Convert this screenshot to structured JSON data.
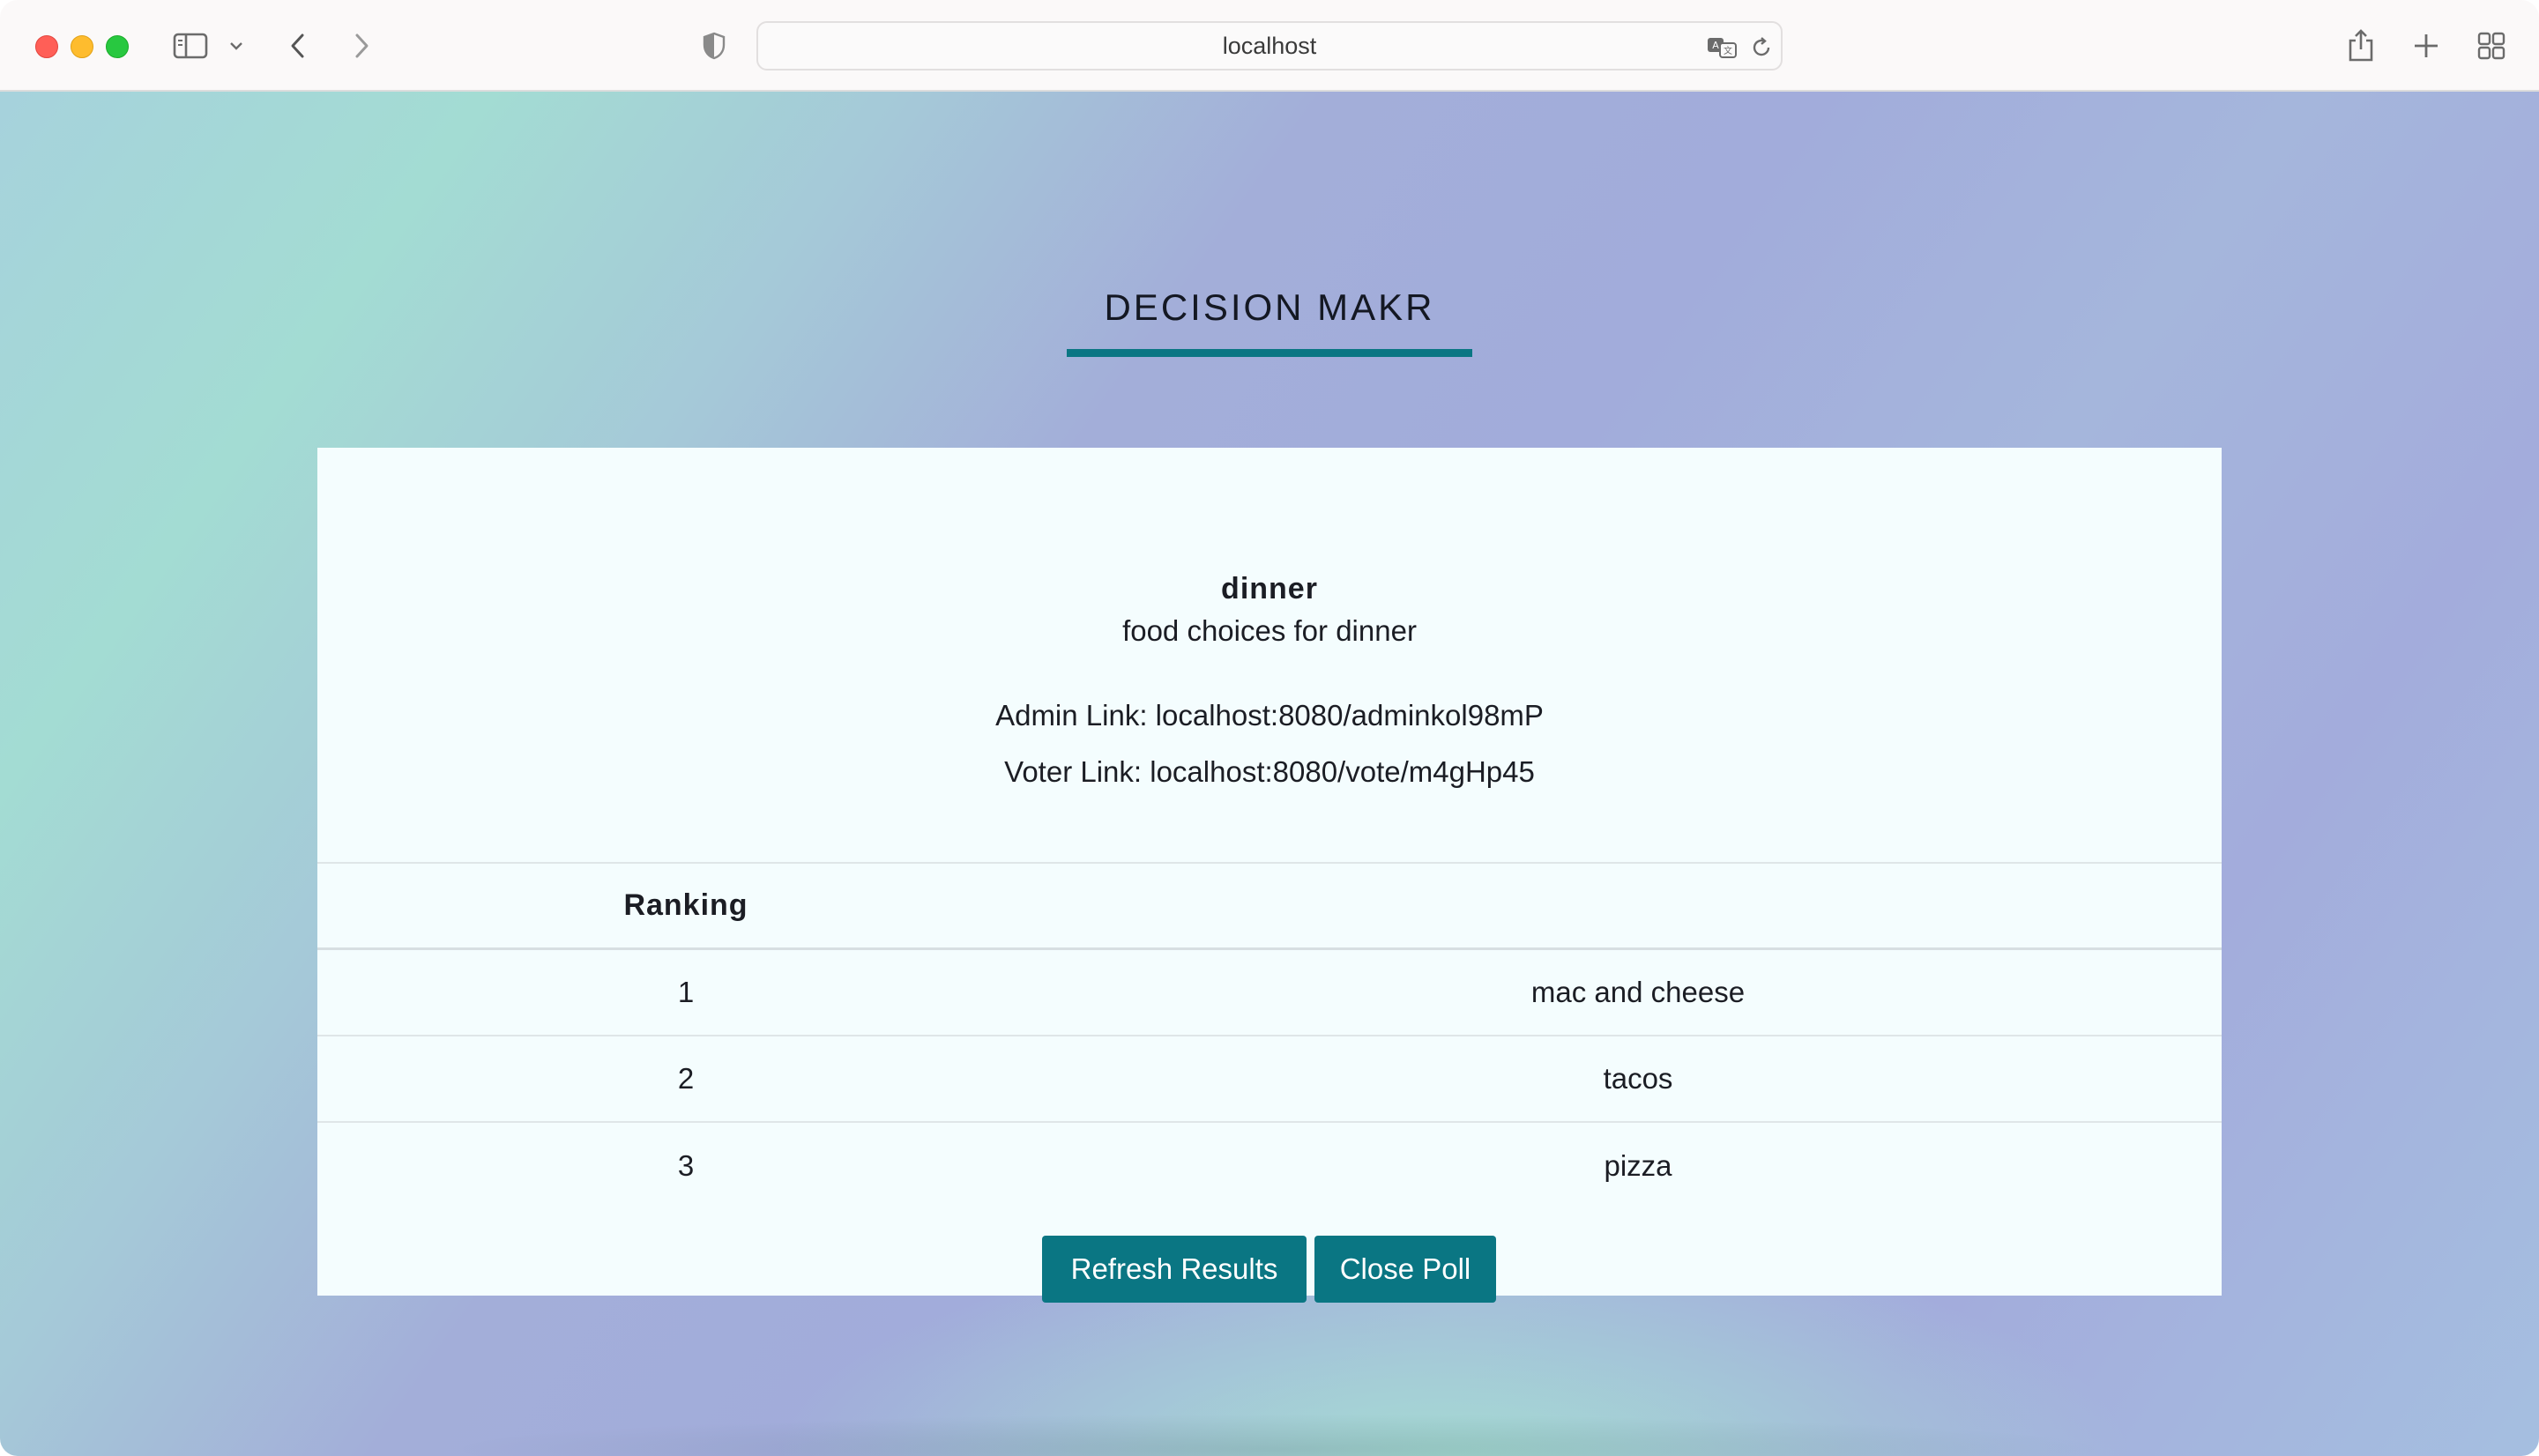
{
  "browser": {
    "url": "localhost",
    "icons": {
      "sidebar": "sidebar-icon",
      "chevron": "chevron-down-icon",
      "back": "back-arrow-icon",
      "forward": "forward-arrow-icon",
      "shield": "privacy-shield-icon",
      "translate": "translate-icon",
      "reload": "reload-icon",
      "share": "share-icon",
      "new_tab": "plus-icon",
      "tab_overview": "tab-grid-icon"
    }
  },
  "site": {
    "title": "DECISION MAKR",
    "accent_color": "#0a7683"
  },
  "poll": {
    "name": "dinner",
    "description": "food choices for dinner",
    "admin_link": "Admin Link: localhost:8080/adminkol98mP",
    "voter_link": "Voter Link: localhost:8080/vote/m4gHp45"
  },
  "results": {
    "header": {
      "rank": "Ranking",
      "choice": ""
    },
    "rows": [
      {
        "rank": "1",
        "choice": "mac and cheese"
      },
      {
        "rank": "2",
        "choice": "tacos"
      },
      {
        "rank": "3",
        "choice": "pizza"
      }
    ]
  },
  "actions": {
    "refresh_label": "Refresh Results",
    "close_label": "Close Poll"
  }
}
